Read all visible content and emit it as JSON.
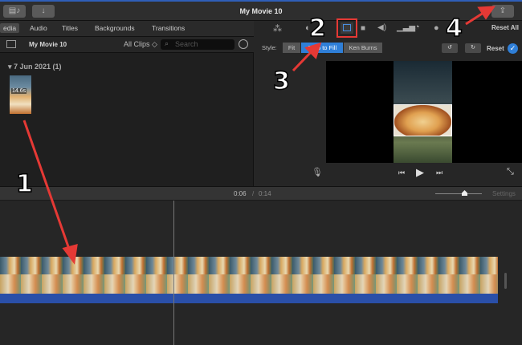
{
  "window": {
    "title": "My Movie 10"
  },
  "tabs": [
    {
      "label": "edia"
    },
    {
      "label": "Audio"
    },
    {
      "label": "Titles"
    },
    {
      "label": "Backgrounds"
    },
    {
      "label": "Transitions"
    }
  ],
  "browser": {
    "library": "My Movie 10",
    "filter": "All Clips ◇",
    "search_placeholder": "Search",
    "date_group": "▾ 7 Jun 2021  (1)",
    "clip_duration": "14.6s"
  },
  "adjust": {
    "reset_all": "Reset All",
    "style_label": "Style:",
    "styles": [
      "Fit",
      "Crop to Fill",
      "Ken Burns"
    ],
    "selected_style": "Crop to Fill",
    "reset": "Reset"
  },
  "timeline": {
    "current": "0:06",
    "separator": "/",
    "total": "0:14",
    "settings": "Settings"
  },
  "annotations": [
    "1",
    "2",
    "3",
    "4"
  ],
  "colors": {
    "accent": "#2f7fd8",
    "annotation": "#e53935",
    "audio": "#2a4fa8"
  }
}
